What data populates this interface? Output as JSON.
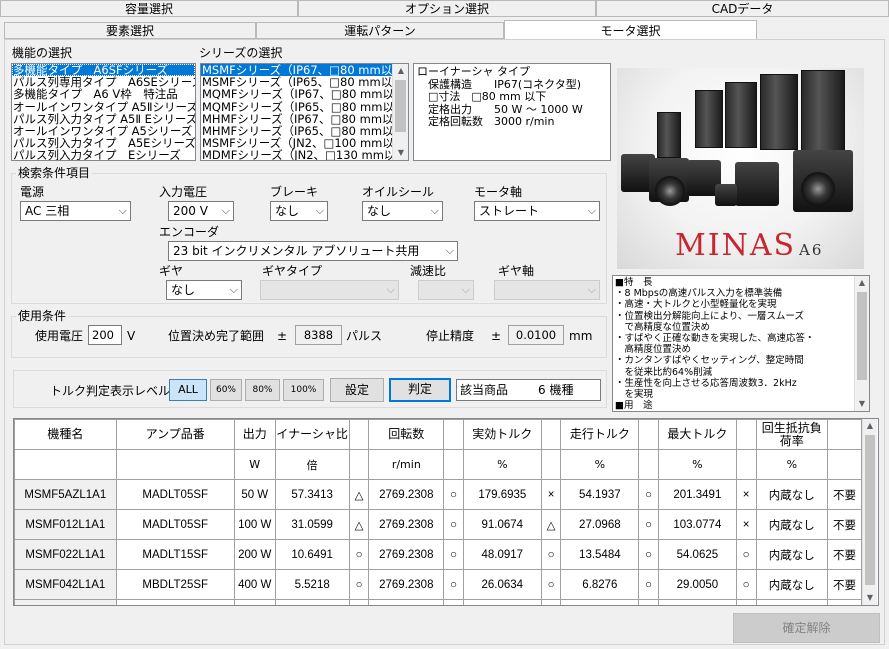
{
  "top_tabs": [
    "容量選択",
    "オプション選択",
    "CADデータ"
  ],
  "sub_tabs": [
    "要素選択",
    "運転パターン",
    "モータ選択"
  ],
  "function_select": {
    "label": "機能の選択",
    "items": [
      "多機能タイプ　A6SFシリーズ",
      "パルス列専用タイプ　A6SEシリーズ",
      "多機能タイプ　A6 V枠　特注品",
      "オールインワンタイプ A5Ⅱシリーズ",
      "パルス列入力タイプ A5Ⅱ Eシリーズ",
      "オールインワンタイプ A5シリーズ",
      "パルス列入力タイプ　A5Eシリーズ",
      "パルス列入力タイプ　Eシリーズ"
    ]
  },
  "series_select": {
    "label": "シリーズの選択",
    "items": [
      "MSMFシリーズ（IP67、□80 mm以下）",
      "MSMFシリーズ（IP65、□80 mm以下）",
      "MQMFシリーズ（IP67、□80 mm以下）",
      "MQMFシリーズ（IP65、□80 mm以下）",
      "MHMFシリーズ（IP67、□80 mm以下）",
      "MHMFシリーズ（IP65、□80 mm以下）",
      "MSMFシリーズ（JN2、□100 mm以上",
      "MDMFシリーズ（JN2、□130 mm以上"
    ]
  },
  "series_info": [
    "ローイナーシャ タイプ",
    "　保護構造　　IP67(コネクタ型)",
    "　□寸法　□80 mm 以下",
    "　定格出力　　50 W ～ 1000 W",
    "　定格回転数　3000 r/min"
  ],
  "product_image": {
    "brand": "MINAS",
    "model": "A6"
  },
  "features": [
    "■特　長",
    "・8 Mbpsの高速パルス入力を標準装備",
    "・高速・大トルクと小型軽量化を実現",
    "・位置検出分解能向上により、一層スムーズ",
    "　で高精度な位置決め",
    "・すばやく正確な動きを実現した、高速応答・",
    "　高精度位置決め",
    "・カンタンすばやくセッティング、整定時間",
    "　を従来比約64%削減",
    "・生産性を向上させる応答周波数3．2kHz",
    "　を実現",
    "■用　途"
  ],
  "search": {
    "legend": "検索条件項目",
    "power_label": "電源",
    "power_value": "AC 三相",
    "voltage_label": "入力電圧",
    "voltage_value": "200 V",
    "brake_label": "ブレーキ",
    "brake_value": "なし",
    "oilseal_label": "オイルシール",
    "oilseal_value": "なし",
    "shaft_label": "モータ軸",
    "shaft_value": "ストレート",
    "encoder_label": "エンコーダ",
    "encoder_value": "23 bit インクリメンタル アブソリュート共用",
    "gear_label": "ギヤ",
    "gear_value": "なし",
    "geartype_label": "ギヤタイプ",
    "ratio_label": "減速比",
    "gearshaft_label": "ギヤ軸"
  },
  "usage": {
    "legend": "使用条件",
    "voltage_label": "使用電圧",
    "voltage_value": "200",
    "voltage_unit": "V",
    "range_label": "位置決め完了範囲",
    "range_pm": "±",
    "range_value": "8388",
    "range_unit": "パルス",
    "accuracy_label": "停止精度",
    "accuracy_pm": "±",
    "accuracy_value": "0.0100",
    "accuracy_unit": "mm"
  },
  "torque": {
    "label": "トルク判定表示レベル",
    "levels": [
      "ALL",
      "60%",
      "80%",
      "100%"
    ],
    "set_button": "設定",
    "judge_button": "判定",
    "result_label": "該当商品",
    "result_value": "6 機種"
  },
  "table": {
    "headers": [
      "機種名",
      "アンプ品番",
      "出力",
      "イナーシャ比",
      "",
      "回転数",
      "",
      "実効トルク",
      "",
      "走行トルク",
      "",
      "最大トルク",
      "",
      "回生抵抗負荷率",
      ""
    ],
    "units": [
      "",
      "",
      "W",
      "倍",
      "",
      "r/min",
      "",
      "%",
      "",
      "%",
      "",
      "%",
      "",
      "%",
      ""
    ],
    "rows": [
      [
        "MSMF5AZL1A1",
        "MADLT05SF",
        "50 W",
        "57.3413",
        "△",
        "2769.2308",
        "○",
        "179.6935",
        "×",
        "54.1937",
        "○",
        "201.3491",
        "×",
        "内蔵なし",
        "不要"
      ],
      [
        "MSMF012L1A1",
        "MADLT05SF",
        "100 W",
        "31.0599",
        "△",
        "2769.2308",
        "○",
        "91.0674",
        "△",
        "27.0968",
        "○",
        "103.0774",
        "×",
        "内蔵なし",
        "不要"
      ],
      [
        "MSMF022L1A1",
        "MADLT15SF",
        "200 W",
        "10.6491",
        "○",
        "2769.2308",
        "○",
        "48.0917",
        "○",
        "13.5484",
        "○",
        "54.0625",
        "○",
        "内蔵なし",
        "不要"
      ],
      [
        "MSMF042L1A1",
        "MBDLT25SF",
        "400 W",
        "5.5218",
        "○",
        "2769.2308",
        "○",
        "26.0634",
        "○",
        "6.8276",
        "○",
        "29.0050",
        "○",
        "内蔵なし",
        "不要"
      ]
    ]
  },
  "confirm_cancel": "確定解除"
}
